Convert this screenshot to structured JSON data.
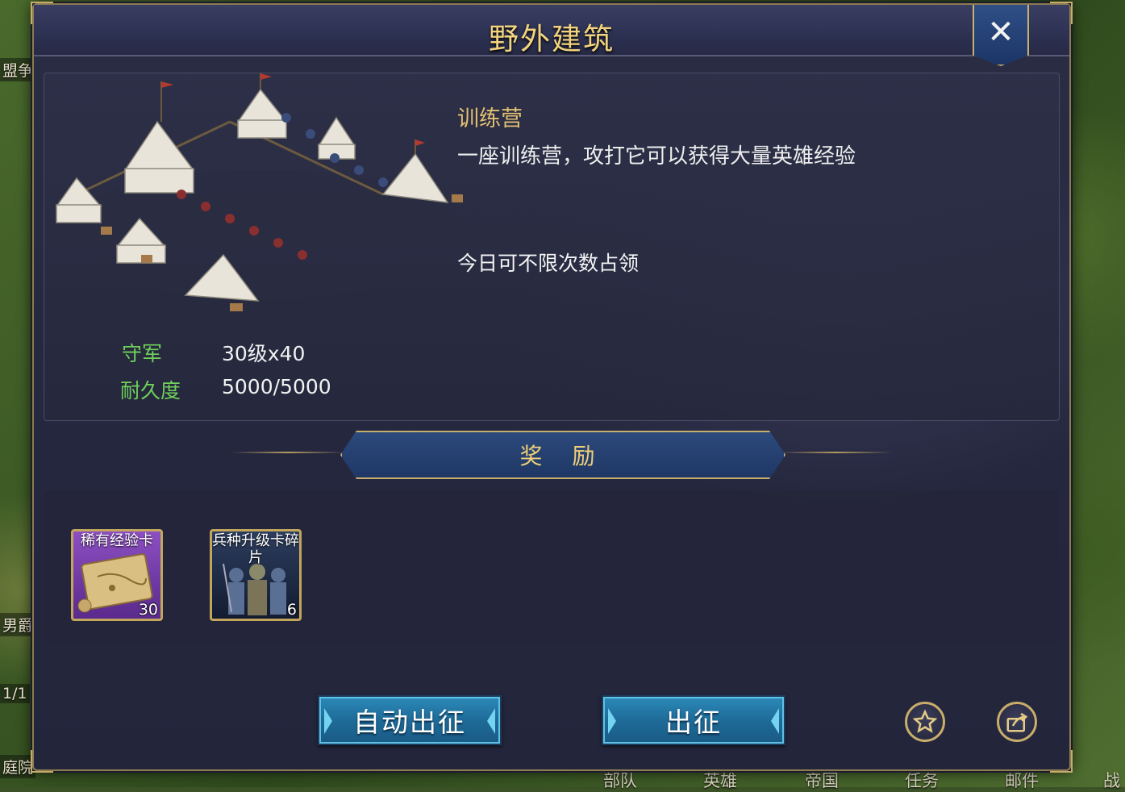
{
  "background": {
    "left_labels": [
      "盟争",
      "男爵",
      "1/1",
      "庭院"
    ],
    "bottom_tabs": [
      "部队",
      "英雄",
      "帝国",
      "任务",
      "邮件",
      "战"
    ]
  },
  "dialog": {
    "title": "野外建筑",
    "building": {
      "name": "训练营",
      "description": "一座训练营，攻打它可以获得大量英雄经验",
      "occupy_note": "今日可不限次数占领"
    },
    "stats": [
      {
        "label": "守军",
        "value": "30级x40"
      },
      {
        "label": "耐久度",
        "value": "5000/5000"
      }
    ],
    "reward_title": "奖 励",
    "rewards": [
      {
        "name": "稀有经验卡",
        "count": "30",
        "icon": "map-scroll-icon"
      },
      {
        "name": "兵种升级卡碎片",
        "count": "6",
        "icon": "soldiers-icon"
      }
    ],
    "buttons": {
      "auto_march": "自动出征",
      "march": "出征"
    },
    "icons": {
      "close": "close-icon",
      "favorite": "star-icon",
      "share": "share-icon"
    }
  },
  "colors": {
    "title": "#f2d37e",
    "stat_label": "#6fd25a",
    "building_name": "#e2c070",
    "button": "#1e6b98"
  }
}
